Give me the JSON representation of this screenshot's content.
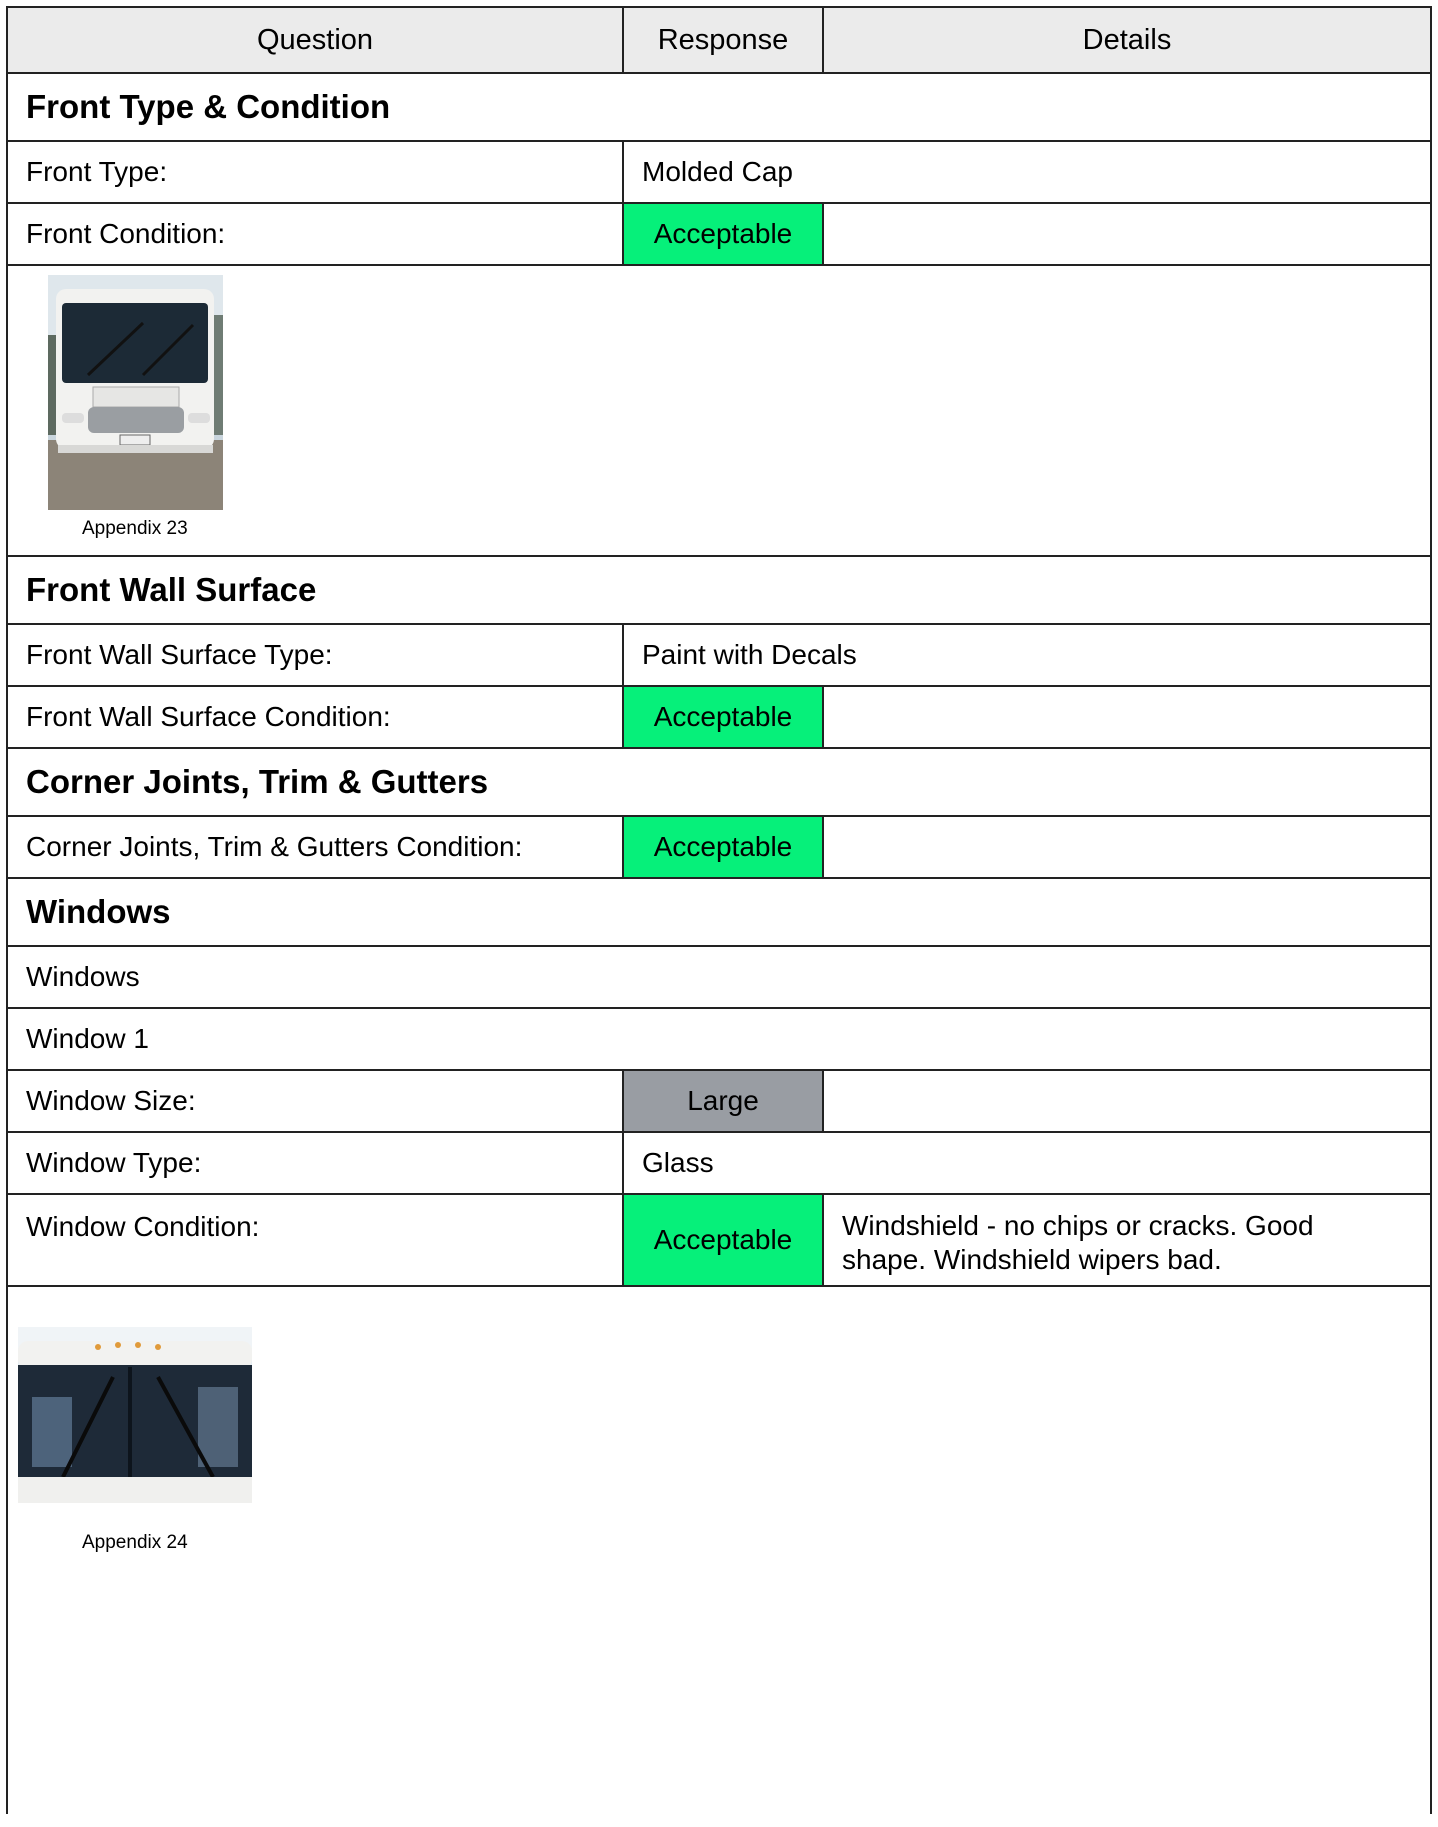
{
  "table": {
    "headers": {
      "question": "Question",
      "response": "Response",
      "details": "Details"
    }
  },
  "sections": {
    "front_type": {
      "title": "Front Type & Condition",
      "front_type_q": "Front Type:",
      "front_type_a": "Molded Cap",
      "front_condition_q": "Front Condition:",
      "front_condition_a": "Acceptable",
      "photo_caption": "Appendix 23"
    },
    "front_wall": {
      "title": "Front Wall Surface",
      "surface_type_q": "Front Wall Surface Type:",
      "surface_type_a": "Paint with Decals",
      "surface_condition_q": "Front Wall Surface Condition:",
      "surface_condition_a": "Acceptable"
    },
    "corner_joints": {
      "title": "Corner Joints, Trim & Gutters",
      "condition_q": "Corner Joints, Trim & Gutters Condition:",
      "condition_a": "Acceptable"
    },
    "windows": {
      "title": "Windows",
      "group_label": "Windows",
      "item_label": "Window 1",
      "size_q": "Window Size:",
      "size_a": "Large",
      "type_q": "Window Type:",
      "type_a": "Glass",
      "condition_q": "Window Condition:",
      "condition_a": "Acceptable",
      "condition_details": "Windshield - no chips or cracks. Good shape. Windshield wipers bad.",
      "photo_caption": "Appendix 24"
    }
  },
  "colors": {
    "acceptable": "#06f07a",
    "neutral": "#999da3",
    "header_bg": "#ebebeb"
  }
}
